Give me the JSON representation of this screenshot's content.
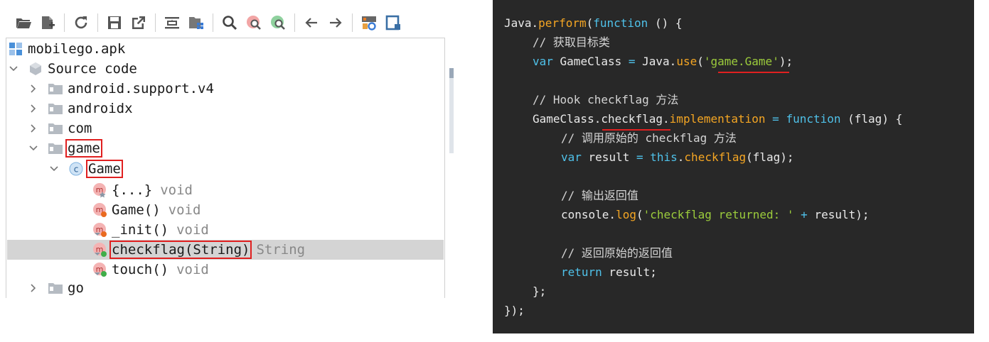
{
  "toolbar": {
    "buttons": [
      "open-folder-icon",
      "add-file-icon",
      "sync-icon",
      "save-icon",
      "export-icon",
      "flatten-icon",
      "package-icon",
      "search-icon",
      "search-class-icon",
      "search-usage-icon",
      "back-icon",
      "forward-icon",
      "deobfuscate-icon",
      "log-viewer-icon"
    ]
  },
  "tree": {
    "root": "mobilego.apk",
    "source_code": "Source code",
    "packages": [
      "android.support.v4",
      "androidx",
      "com",
      "game",
      "go"
    ],
    "class_name": "Game",
    "methods": [
      {
        "name": "{...}",
        "ret": "void"
      },
      {
        "name": "Game()",
        "ret": "void"
      },
      {
        "name": "_init()",
        "ret": "void"
      },
      {
        "name": "checkflag(String)",
        "ret": "String"
      },
      {
        "name": "touch()",
        "ret": "void"
      }
    ]
  },
  "code": {
    "l1": {
      "a": "Java.",
      "b": "perform",
      "c": "(",
      "d": "function",
      "e": " () {"
    },
    "l2": "// 获取目标类",
    "l3": {
      "a": "var",
      "b": " GameClass ",
      "c": "=",
      "d": " Java.",
      "e": "use",
      "f": "(",
      "g": "'game.Game'",
      "h": ");"
    },
    "l4": "// Hook checkflag 方法",
    "l5": {
      "a": "GameClass.",
      "b": "checkflag",
      "c": ".",
      "d": "implementation",
      "e": " ",
      "f": "=",
      "g": " ",
      "h": "function",
      "i": " (flag) {"
    },
    "l6": "// 调用原始的 checkflag 方法",
    "l7": {
      "a": "var",
      "b": " result ",
      "c": "=",
      "d": " ",
      "e": "this",
      "f": ".",
      "g": "checkflag",
      "h": "(flag);"
    },
    "l8": "// 输出返回值",
    "l9": {
      "a": "console.",
      "b": "log",
      "c": "(",
      "d": "'checkflag returned: '",
      "e": " ",
      "f": "+",
      "g": " result);"
    },
    "l10": "// 返回原始的返回值",
    "l11": {
      "a": "return",
      "b": " result;"
    },
    "l12": "};",
    "l13": "});"
  },
  "colors": {
    "code_bg": "#282828",
    "keyword": "#4fc1e9",
    "function": "#f5a623",
    "string": "#9ccc3c",
    "highlight_red": "#e02020",
    "selected_row": "#d4d4d4"
  }
}
